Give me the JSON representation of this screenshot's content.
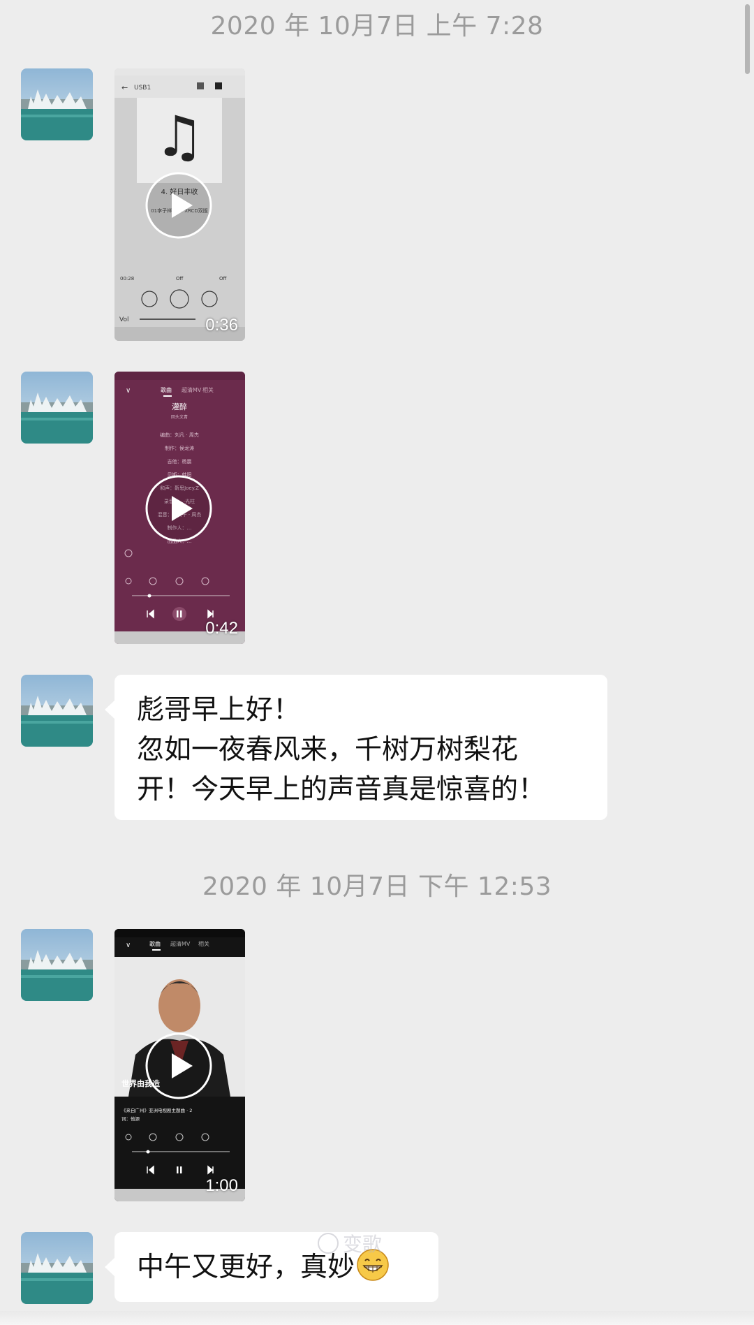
{
  "chat": {
    "timestamp_1": "2020 年 10月7日 上午 7:28",
    "timestamp_2": "2020 年 10月7日 下午 12:53"
  },
  "messages": {
    "video_1": {
      "duration": "0:36",
      "header_text": "USB1",
      "track_title": "4. 好日丰收",
      "track_subtitle": "01李子祥·跟...·XRCD双版",
      "time": "00:28",
      "repeat": "Off",
      "shuffle": "Off",
      "vol_label": "Vol"
    },
    "video_2": {
      "duration": "0:42",
      "tabs": [
        "歌曲",
        "超清MV",
        "相关"
      ],
      "song_title": "灌醉",
      "song_artist": "回头文青",
      "credits": [
        "编曲：刘凡 · 周杰",
        "制作：侯龙涛",
        "吉他：杨震",
        "贝斯：韩阳",
        "和声：靳思Joey.Z",
        "录音：…·光柱",
        "混音：刘贯午 · 周杰",
        "制作人：…",
        "出品人：…"
      ]
    },
    "text_1": {
      "lines": [
        "彪哥早上好！",
        "忽如一夜春风来，千树万树梨花",
        "开！今天早上的声音真是惊喜的！"
      ]
    },
    "video_3": {
      "duration": "1:00",
      "tabs": [
        "歌曲",
        "超清MV",
        "相关"
      ],
      "song_title": "世界由我造",
      "song_meta": "《来自广州》亚洲电视剧主题曲 · 2",
      "lyricist": "词：他源"
    },
    "text_2": {
      "text": "中午又更好，真妙",
      "emoji": "grinning-face-icon"
    }
  },
  "watermark": {
    "text": "变歌"
  },
  "colors": {
    "background": "#ededed",
    "bubble": "#ffffff",
    "timestamp": "#9b9b9b",
    "purple_player": "#6b2b4c"
  }
}
